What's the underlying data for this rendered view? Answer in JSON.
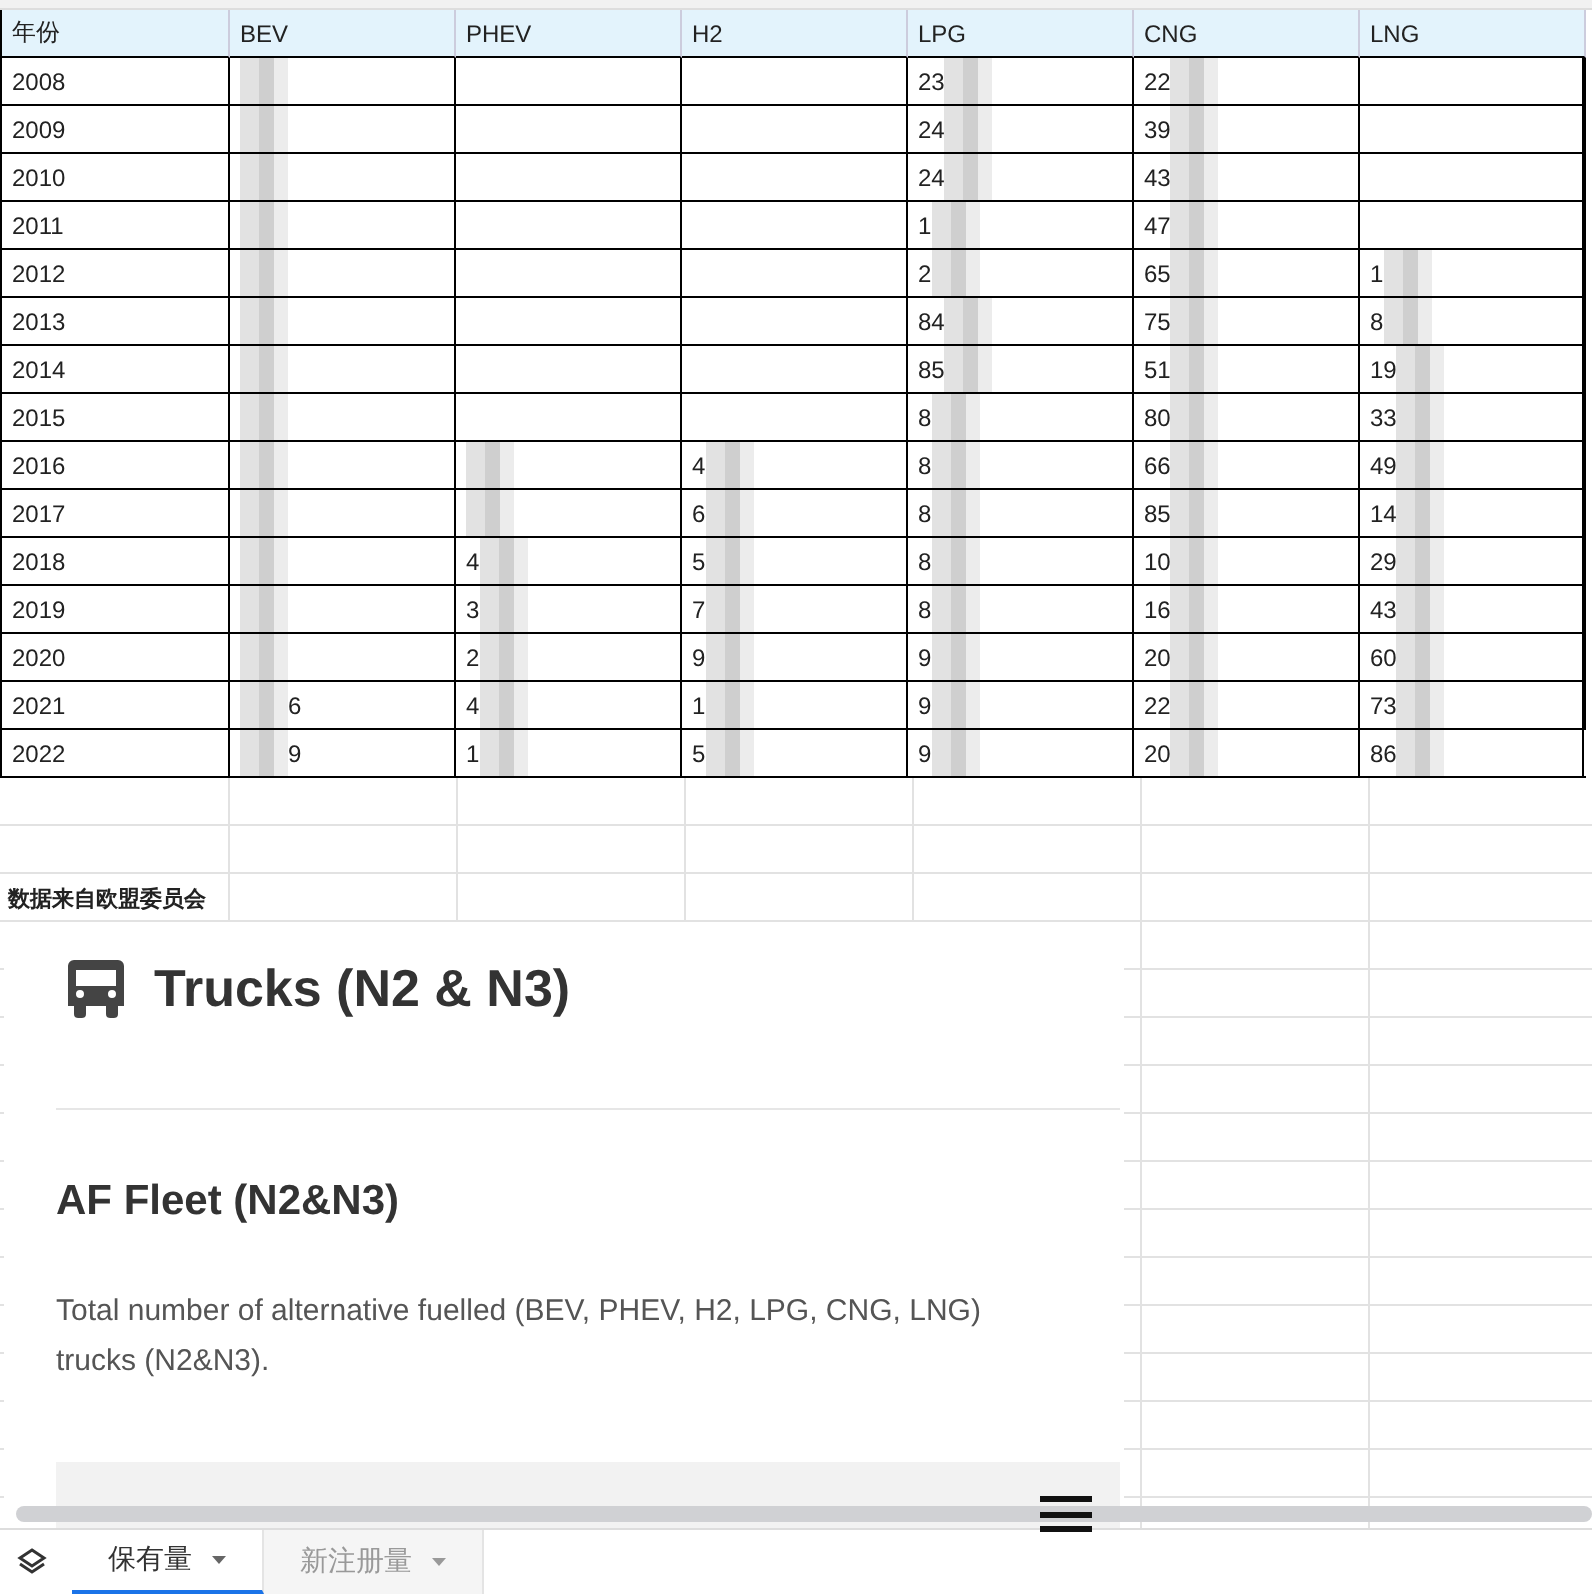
{
  "table": {
    "columns": [
      "年份",
      "BEV",
      "PHEV",
      "H2",
      "LPG",
      "CNG",
      "LNG"
    ],
    "rows": [
      {
        "cells": [
          {
            "text": "2008"
          },
          {
            "blurred": true
          },
          {},
          {},
          {
            "text": "23",
            "blurred": true
          },
          {
            "text": "22",
            "blurred": true
          },
          {}
        ]
      },
      {
        "cells": [
          {
            "text": "2009"
          },
          {
            "blurred": true
          },
          {},
          {},
          {
            "text": "24",
            "blurred": true
          },
          {
            "text": "39",
            "blurred": true
          },
          {}
        ]
      },
      {
        "cells": [
          {
            "text": "2010"
          },
          {
            "blurred": true
          },
          {},
          {},
          {
            "text": "24",
            "blurred": true
          },
          {
            "text": "43",
            "blurred": true
          },
          {}
        ]
      },
      {
        "cells": [
          {
            "text": "2011"
          },
          {
            "blurred": true
          },
          {},
          {},
          {
            "text": "1",
            "blurred": true
          },
          {
            "text": "47",
            "blurred": true
          },
          {}
        ]
      },
      {
        "cells": [
          {
            "text": "2012"
          },
          {
            "blurred": true
          },
          {},
          {},
          {
            "text": "2",
            "blurred": true
          },
          {
            "text": "65",
            "blurred": true
          },
          {
            "text": "1",
            "blurred": true
          }
        ]
      },
      {
        "cells": [
          {
            "text": "2013"
          },
          {
            "blurred": true
          },
          {},
          {},
          {
            "text": "84",
            "blurred": true
          },
          {
            "text": "75",
            "blurred": true
          },
          {
            "text": "8",
            "blurred": true
          }
        ]
      },
      {
        "cells": [
          {
            "text": "2014"
          },
          {
            "blurred": true
          },
          {},
          {},
          {
            "text": "85",
            "blurred": true
          },
          {
            "text": "51",
            "blurred": true
          },
          {
            "text": "19",
            "blurred": true
          }
        ]
      },
      {
        "cells": [
          {
            "text": "2015"
          },
          {
            "blurred": true
          },
          {},
          {},
          {
            "text": "8",
            "blurred": true
          },
          {
            "text": "80",
            "blurred": true
          },
          {
            "text": "33",
            "blurred": true
          }
        ]
      },
      {
        "cells": [
          {
            "text": "2016"
          },
          {
            "blurred": true
          },
          {
            "blurred": true
          },
          {
            "text": "4",
            "blurred": true
          },
          {
            "text": "8",
            "blurred": true
          },
          {
            "text": "66",
            "blurred": true
          },
          {
            "text": "49",
            "blurred": true
          }
        ]
      },
      {
        "cells": [
          {
            "text": "2017"
          },
          {
            "blurred": true
          },
          {
            "blurred": true
          },
          {
            "text": "6",
            "blurred": true
          },
          {
            "text": "8",
            "blurred": true
          },
          {
            "text": "85",
            "blurred": true
          },
          {
            "text": "14",
            "blurred": true
          }
        ]
      },
      {
        "cells": [
          {
            "text": "2018"
          },
          {
            "blurred": true
          },
          {
            "text": "4",
            "blurred": true
          },
          {
            "text": "5",
            "blurred": true
          },
          {
            "text": "8",
            "blurred": true
          },
          {
            "text": "10",
            "blurred": true
          },
          {
            "text": "29",
            "blurred": true
          }
        ]
      },
      {
        "cells": [
          {
            "text": "2019"
          },
          {
            "blurred": true
          },
          {
            "text": "3",
            "blurred": true
          },
          {
            "text": "7",
            "blurred": true
          },
          {
            "text": "8",
            "blurred": true
          },
          {
            "text": "16",
            "blurred": true
          },
          {
            "text": "43",
            "blurred": true
          }
        ]
      },
      {
        "cells": [
          {
            "text": "2020"
          },
          {
            "blurred": true
          },
          {
            "text": "2",
            "blurred": true
          },
          {
            "text": "9",
            "blurred": true
          },
          {
            "text": "9",
            "blurred": true
          },
          {
            "text": "20",
            "blurred": true
          },
          {
            "text": "60",
            "blurred": true
          }
        ]
      },
      {
        "cells": [
          {
            "text": "2021"
          },
          {
            "text": "6",
            "blurred": true,
            "blur_first": true
          },
          {
            "text": "4",
            "blurred": true
          },
          {
            "text": "1",
            "blurred": true
          },
          {
            "text": "9",
            "blurred": true
          },
          {
            "text": "22",
            "blurred": true
          },
          {
            "text": "73",
            "blurred": true
          }
        ]
      },
      {
        "cells": [
          {
            "text": "2022"
          },
          {
            "text": "9",
            "blurred": true,
            "blur_first": true
          },
          {
            "text": "1",
            "blurred": true
          },
          {
            "text": "5",
            "blurred": true
          },
          {
            "text": "9",
            "blurred": true
          },
          {
            "text": "20",
            "blurred": true
          },
          {
            "text": "86",
            "blurred": true
          }
        ]
      }
    ]
  },
  "note": "数据来自欧盟委员会",
  "embed": {
    "title": "Trucks (N2 & N3)",
    "heading": "AF Fleet (N2&N3)",
    "description": "Total number of alternative fuelled (BEV, PHEV, H2, LPG, CNG, LNG) trucks (N2&N3)."
  },
  "sheet_tabs": [
    {
      "label": "保有量",
      "selected": true
    },
    {
      "label": "新注册量",
      "selected": false
    }
  ]
}
